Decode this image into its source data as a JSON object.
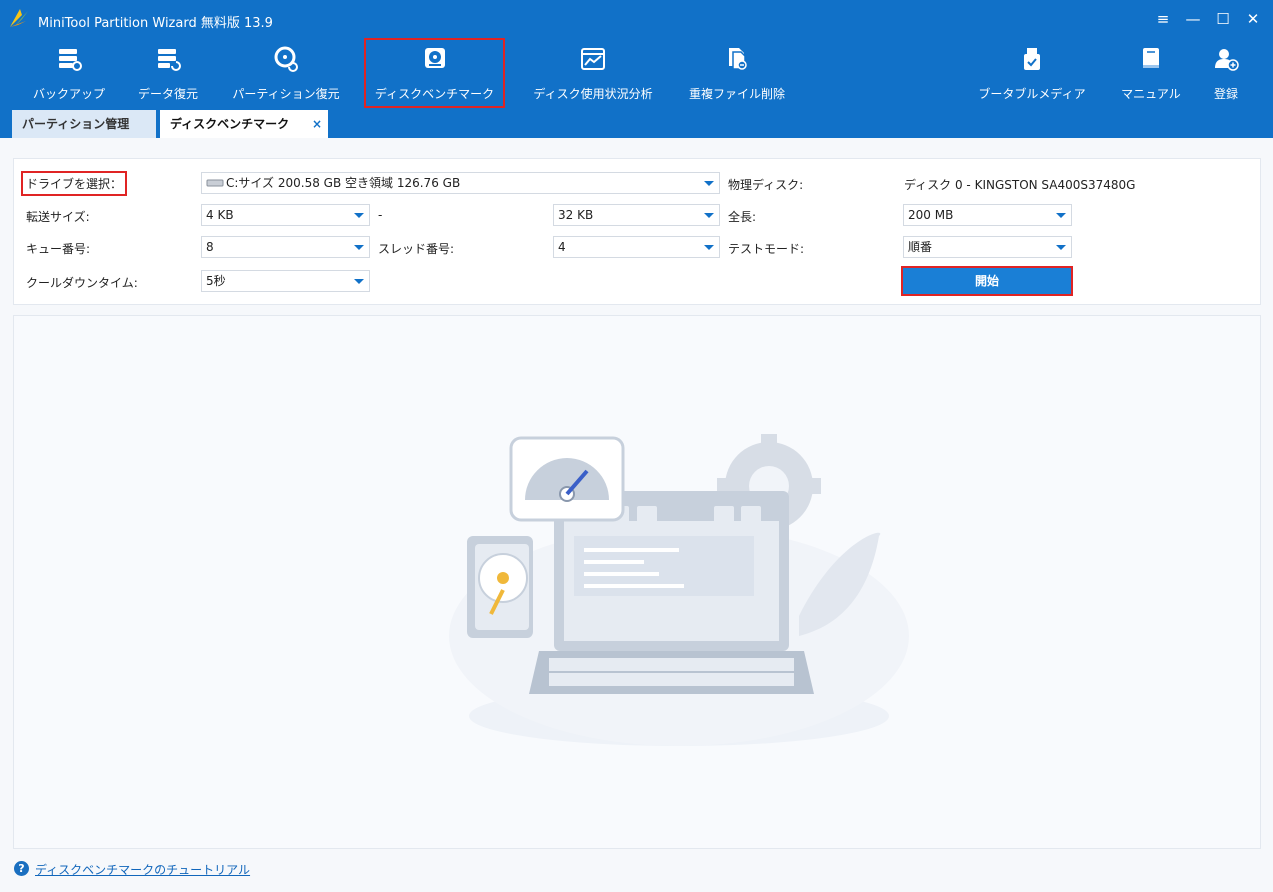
{
  "window": {
    "title": "MiniTool Partition Wizard 無料版 13.9",
    "controls": [
      "≡",
      "—",
      "☐",
      "✕"
    ]
  },
  "toolbar": {
    "items": [
      {
        "label": "バックアップ",
        "icon": "backup-icon"
      },
      {
        "label": "データ復元",
        "icon": "data-recovery-icon"
      },
      {
        "label": "パーティション復元",
        "icon": "partition-recovery-icon"
      },
      {
        "label": "ディスクベンチマーク",
        "icon": "disk-benchmark-icon"
      },
      {
        "label": "ディスク使用状況分析",
        "icon": "space-analyzer-icon"
      },
      {
        "label": "重複ファイル削除",
        "icon": "duplicate-file-icon"
      },
      {
        "label": "ブータブルメディア",
        "icon": "bootable-media-icon"
      },
      {
        "label": "マニュアル",
        "icon": "manual-icon"
      },
      {
        "label": "登録",
        "icon": "register-icon"
      }
    ]
  },
  "tabs": {
    "partition": "パーティション管理",
    "benchmark": "ディスクベンチマーク",
    "close": "×"
  },
  "settings": {
    "drive_label": "ドライブを選択：",
    "drive_value": "C:サイズ 200.58 GB 空き領域 126.76 GB",
    "physical_label": "物理ディスク:",
    "physical_value": "ディスク 0 - KINGSTON SA400S37480G",
    "transfer_label": "転送サイズ:",
    "transfer_from": "4 KB",
    "transfer_dash": "-",
    "transfer_to": "32 KB",
    "total_label": "全長:",
    "total_value": "200 MB",
    "queue_label": "キュー番号:",
    "queue_value": "8",
    "thread_label": "スレッド番号:",
    "thread_value": "4",
    "mode_label": "テストモード:",
    "mode_value": "順番",
    "cooldown_label": "クールダウンタイム:",
    "cooldown_value": "5秒",
    "start_button": "開始"
  },
  "footer": {
    "help_icon": "?",
    "tutorial_link": "ディスクベンチマークのチュートリアル"
  },
  "colors": {
    "brand_blue": "#1171c8",
    "button_blue": "#1a7fd6",
    "highlight_red": "#e02424"
  }
}
